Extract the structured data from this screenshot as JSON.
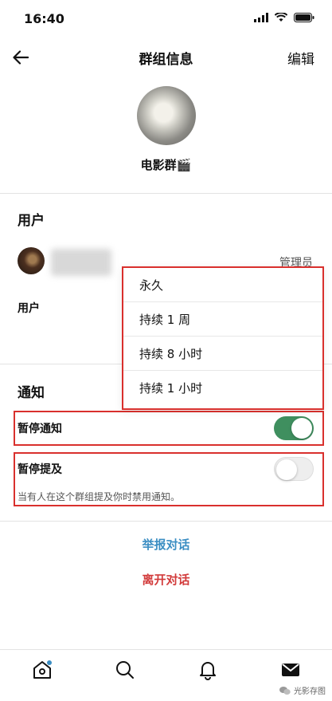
{
  "status": {
    "time": "16:40"
  },
  "nav": {
    "title": "群组信息",
    "edit_label": "编辑"
  },
  "group": {
    "name": "电影群🎬"
  },
  "users": {
    "section_title": "用户",
    "role": "管理员",
    "user_label": "用户"
  },
  "mute_menu": {
    "options": [
      "永久",
      "持续 1 周",
      "持续 8 小时",
      "持续 1 小时"
    ]
  },
  "notifications": {
    "section_title": "通知",
    "pause_notifications": {
      "label": "暂停通知",
      "on": true
    },
    "pause_mentions": {
      "label": "暂停提及",
      "on": false,
      "description": "当有人在这个群组提及你时禁用通知。"
    }
  },
  "actions": {
    "report": "举报对话",
    "leave": "离开对话"
  },
  "tabs": [
    "home-icon",
    "search-icon",
    "bell-icon",
    "mail-icon"
  ],
  "watermark": {
    "text": "光影存图"
  },
  "colors": {
    "accent_green": "#3f8f5f",
    "highlight_red": "#d9302d",
    "link_blue": "#3b8ec3",
    "danger_red": "#d23b3b"
  }
}
